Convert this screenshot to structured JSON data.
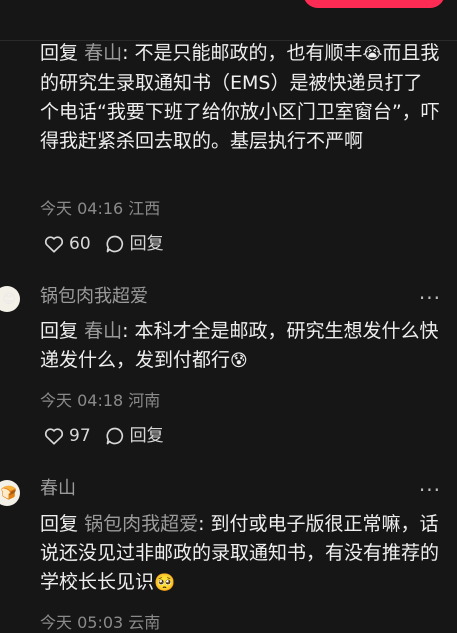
{
  "comments": [
    {
      "reply_prefix": "回复",
      "reply_to": "春山",
      "text_a": ": 不是只能邮政的，也有顺丰",
      "emoji_a": "😭",
      "text_b": "而且我的研究生录取通知书（EMS）是被快递员打了个电话“我要下班了给你放小区门卫室窗台”，吓得我赶紧杀回去取的。基层执行不严啊",
      "time": "今天 04:16",
      "location": "江西",
      "likes": "60",
      "reply_label": "回复"
    },
    {
      "author": "锅包肉我超爱",
      "avatar_icon": "😊",
      "reply_prefix": "回复",
      "reply_to": "春山",
      "text_a": ": 本科才全是邮政，研究生想发什么快递发什么，发到付都行",
      "emoji_a": "😰",
      "time": "今天 04:18",
      "location": "河南",
      "likes": "97",
      "reply_label": "回复",
      "more_label": "···"
    },
    {
      "author": "春山",
      "avatar_icon": "🍞",
      "reply_prefix": "回复",
      "reply_to": "锅包肉我超爱",
      "text_a": ": 到付或电子版很正常嘛，话说还没见过非邮政的录取通知书，有没有推荐的学校长长见识",
      "emoji_a": "🥺",
      "time_partial": "今天 05:03  云南",
      "more_label": "···"
    }
  ],
  "colors": {
    "accent": "#fe2c55",
    "background": "#161616",
    "muted": "#9a9a9a"
  }
}
